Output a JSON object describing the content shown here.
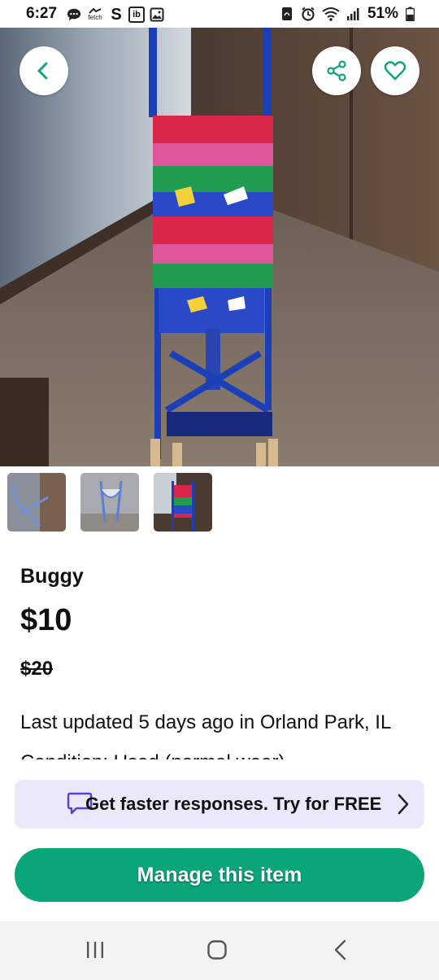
{
  "status_bar": {
    "time": "6:27",
    "battery": "51%",
    "left_icons": [
      "chat-bubble-icon",
      "fetch-icon",
      "s-icon",
      "ib-icon",
      "image-icon"
    ],
    "right_icons": [
      "nfc-icon",
      "alarm-icon",
      "wifi-icon",
      "signal-icon",
      "battery-icon"
    ],
    "fetch_label": "fetch",
    "ib_label": "ib"
  },
  "listing": {
    "title": "Buggy",
    "price": "$10",
    "original_price": "$20",
    "updated_text": "Last updated 5 days ago in Orland Park, IL",
    "condition_text": "Condition: Used (normal wear)"
  },
  "promo": {
    "text": "Get faster responses. Try for FREE"
  },
  "actions": {
    "manage_label": "Manage this item"
  },
  "colors": {
    "accent_green": "#0aa57a",
    "promo_bg": "#ece8fb",
    "promo_icon": "#5b3fd6"
  }
}
